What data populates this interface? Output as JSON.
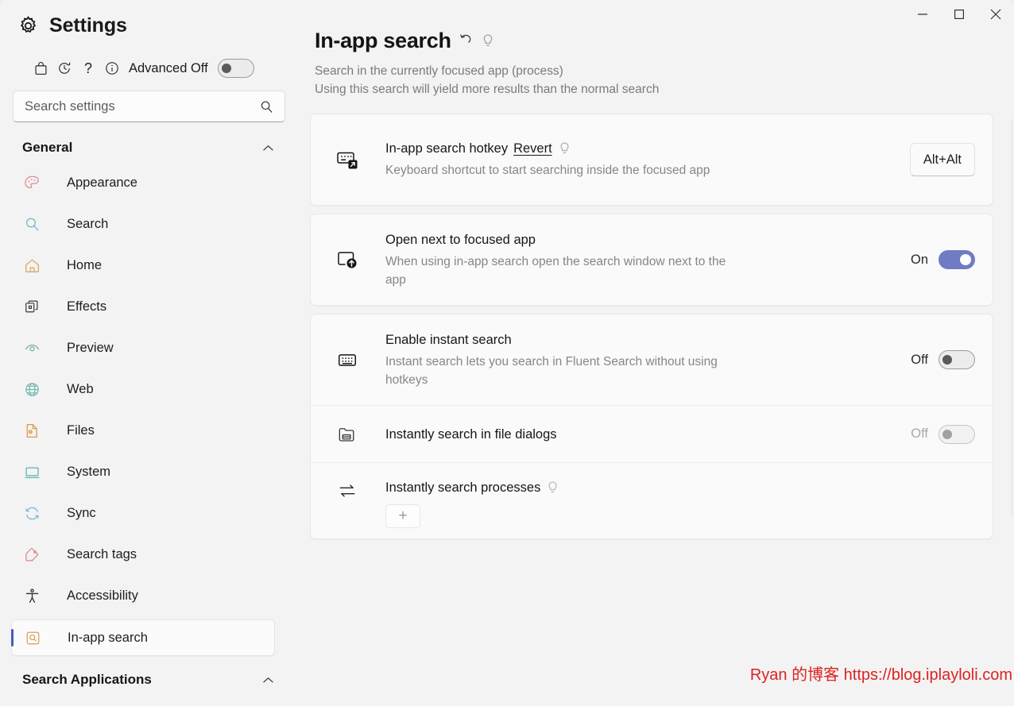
{
  "window": {
    "title": "Settings",
    "controls": {
      "minimize": "minimize-button",
      "maximize": "maximize-button",
      "close": "close-button"
    }
  },
  "toolbar": {
    "store_icon": "store-bag-icon",
    "history_icon": "history-reset-icon",
    "help_icon": "question-mark-icon",
    "info_icon": "info-circle-icon",
    "advanced_label": "Advanced Off",
    "advanced_state": "off"
  },
  "search": {
    "placeholder": "Search settings",
    "value": "",
    "icon": "search-icon"
  },
  "sidebar": {
    "groups": [
      {
        "label": "General",
        "expanded": true,
        "items": [
          {
            "label": "Appearance",
            "icon": "palette-icon",
            "color": "#d98a96",
            "selected": false
          },
          {
            "label": "Search",
            "icon": "magnifier-icon",
            "color": "#7fb6c9",
            "selected": false
          },
          {
            "label": "Home",
            "icon": "house-icon",
            "color": "#e0a765",
            "selected": false
          },
          {
            "label": "Effects",
            "icon": "layers-icon",
            "color": "#3a3a3a",
            "selected": false
          },
          {
            "label": "Preview",
            "icon": "eye-icon",
            "color": "#6fb3ad",
            "selected": false
          },
          {
            "label": "Web",
            "icon": "globe-icon",
            "color": "#74b8b0",
            "selected": false
          },
          {
            "label": "Files",
            "icon": "file-lock-icon",
            "color": "#d99a45",
            "selected": false
          },
          {
            "label": "System",
            "icon": "monitor-icon",
            "color": "#5fb3b3",
            "selected": false
          },
          {
            "label": "Sync",
            "icon": "sync-icon",
            "color": "#79bcd8",
            "selected": false
          },
          {
            "label": "Search tags",
            "icon": "tag-icon",
            "color": "#e08d8d",
            "selected": false
          },
          {
            "label": "Accessibility",
            "icon": "accessibility-icon",
            "color": "#2f2f2f",
            "selected": false
          },
          {
            "label": "In-app search",
            "icon": "in-app-search-icon",
            "color": "#d8a055",
            "selected": true
          }
        ]
      },
      {
        "label": "Search Applications",
        "expanded": true,
        "items": []
      }
    ],
    "accent_color": "#4a5bb8"
  },
  "main": {
    "title": "In-app search",
    "title_icons": [
      "undo-icon",
      "lightbulb-icon"
    ],
    "description_lines": [
      "Search in the currently focused app (process)",
      "Using this search will yield more results than the normal search"
    ],
    "cards": [
      {
        "rows": [
          {
            "icon": "keyboard-external-icon",
            "title": "In-app search hotkey",
            "link": "Revert",
            "has_bulb": true,
            "description": "Keyboard shortcut to start searching inside the focused app",
            "control": "hotkey",
            "hotkey_value": "Alt+Alt"
          }
        ]
      },
      {
        "rows": [
          {
            "icon": "window-arrow-up-icon",
            "title": "Open next to focused app",
            "link": "",
            "has_bulb": false,
            "description": "When using in-app search open the search window next to the app",
            "control": "toggle",
            "state_label": "On",
            "state": "on"
          }
        ]
      },
      {
        "rows": [
          {
            "icon": "keyboard-icon",
            "title": "Enable instant search",
            "link": "",
            "has_bulb": false,
            "description": "Instant search lets you search in Fluent Search without using hotkeys",
            "control": "toggle",
            "state_label": "Off",
            "state": "off"
          },
          {
            "icon": "folder-dialog-icon",
            "title": "Instantly search in file dialogs",
            "link": "",
            "has_bulb": false,
            "description": "",
            "control": "toggle",
            "state_label": "Off",
            "state": "off",
            "dimmed": true
          },
          {
            "icon": "swap-arrows-icon",
            "title": "Instantly search processes",
            "link": "",
            "has_bulb": true,
            "description": "",
            "control": "add",
            "add_label": "+"
          }
        ]
      }
    ]
  },
  "watermark": {
    "text": "Ryan 的博客 https://blog.iplayloli.com",
    "color": "#dd2222"
  },
  "colors": {
    "page_background": "#f3f3f3",
    "card_background": "#fafafa",
    "toggle_on": "#6f7cc4",
    "accent": "#4a5bb8",
    "title_text": "#141414",
    "muted_text": "#868686"
  }
}
